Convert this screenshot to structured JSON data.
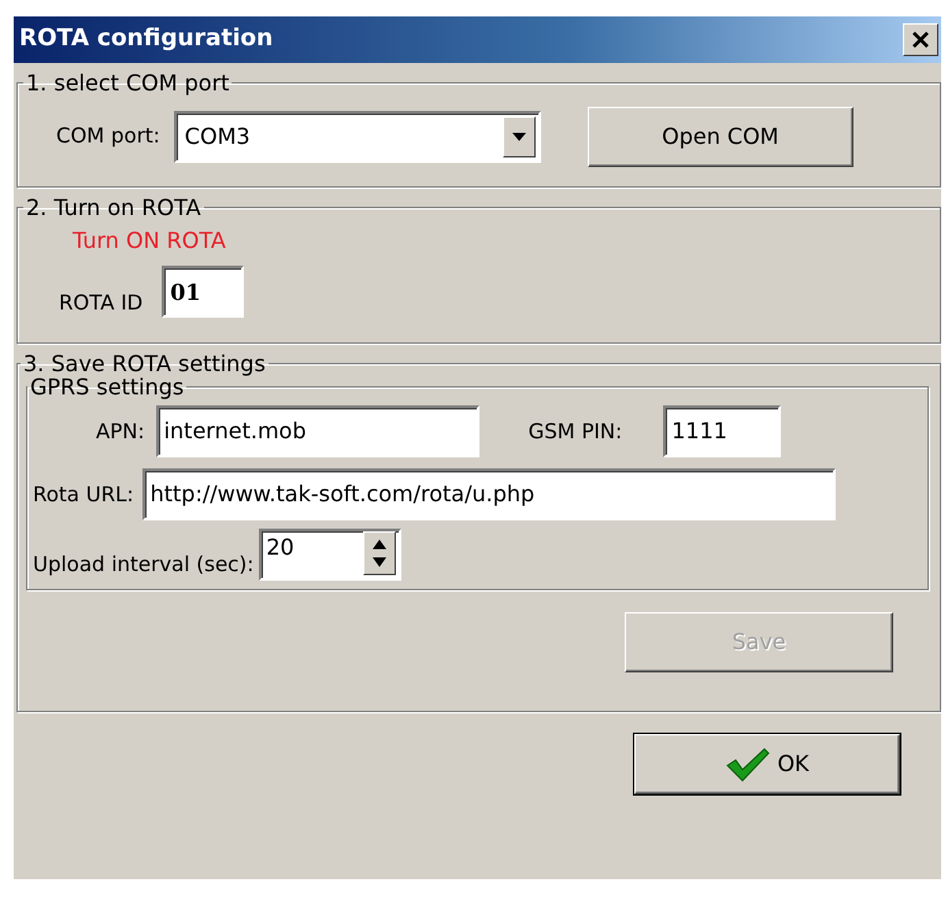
{
  "window": {
    "title": "ROTA configuration"
  },
  "com_group": {
    "legend": "1. select COM port",
    "label": "COM port:",
    "value": "COM3",
    "button": {
      "label": "Open COM",
      "disabled": false
    }
  },
  "rota_group": {
    "legend": "2. Turn on ROTA",
    "status": "Turn ON ROTA",
    "id_label": "ROTA ID",
    "id_value": "01"
  },
  "save_group": {
    "legend": "3. Save ROTA settings",
    "gprs": {
      "legend": "GPRS settings",
      "apn_label": "APN:",
      "apn_value": "internet.mob",
      "pin_label": "GSM PIN:",
      "pin_value": "1111",
      "url_label": "Rota URL:",
      "url_value": "http://www.tak-soft.com/rota/u.php",
      "interval_label": "Upload interval (sec):",
      "interval_value": "20"
    },
    "button": {
      "label": "Save",
      "disabled": true
    }
  },
  "ok_button": {
    "label": "OK",
    "disabled": false
  }
}
